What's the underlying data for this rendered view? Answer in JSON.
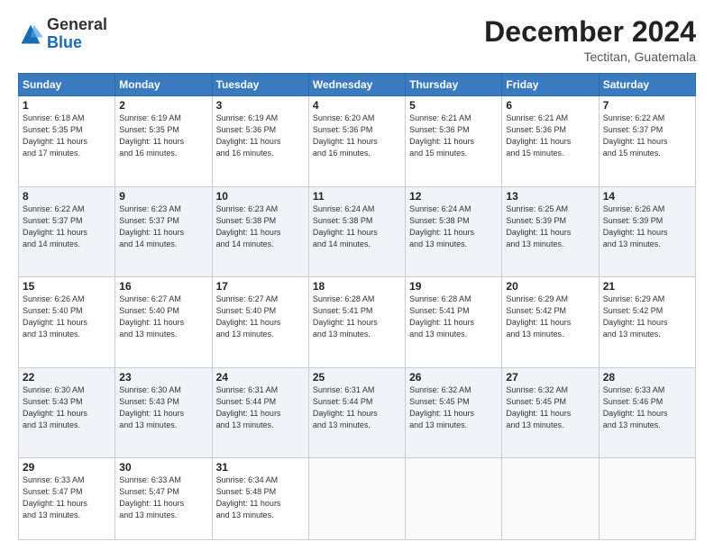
{
  "header": {
    "logo_general": "General",
    "logo_blue": "Blue",
    "month_title": "December 2024",
    "location": "Tectitan, Guatemala"
  },
  "days_of_week": [
    "Sunday",
    "Monday",
    "Tuesday",
    "Wednesday",
    "Thursday",
    "Friday",
    "Saturday"
  ],
  "weeks": [
    [
      {
        "day": "1",
        "info": "Sunrise: 6:18 AM\nSunset: 5:35 PM\nDaylight: 11 hours\nand 17 minutes."
      },
      {
        "day": "2",
        "info": "Sunrise: 6:19 AM\nSunset: 5:35 PM\nDaylight: 11 hours\nand 16 minutes."
      },
      {
        "day": "3",
        "info": "Sunrise: 6:19 AM\nSunset: 5:36 PM\nDaylight: 11 hours\nand 16 minutes."
      },
      {
        "day": "4",
        "info": "Sunrise: 6:20 AM\nSunset: 5:36 PM\nDaylight: 11 hours\nand 16 minutes."
      },
      {
        "day": "5",
        "info": "Sunrise: 6:21 AM\nSunset: 5:36 PM\nDaylight: 11 hours\nand 15 minutes."
      },
      {
        "day": "6",
        "info": "Sunrise: 6:21 AM\nSunset: 5:36 PM\nDaylight: 11 hours\nand 15 minutes."
      },
      {
        "day": "7",
        "info": "Sunrise: 6:22 AM\nSunset: 5:37 PM\nDaylight: 11 hours\nand 15 minutes."
      }
    ],
    [
      {
        "day": "8",
        "info": "Sunrise: 6:22 AM\nSunset: 5:37 PM\nDaylight: 11 hours\nand 14 minutes."
      },
      {
        "day": "9",
        "info": "Sunrise: 6:23 AM\nSunset: 5:37 PM\nDaylight: 11 hours\nand 14 minutes."
      },
      {
        "day": "10",
        "info": "Sunrise: 6:23 AM\nSunset: 5:38 PM\nDaylight: 11 hours\nand 14 minutes."
      },
      {
        "day": "11",
        "info": "Sunrise: 6:24 AM\nSunset: 5:38 PM\nDaylight: 11 hours\nand 14 minutes."
      },
      {
        "day": "12",
        "info": "Sunrise: 6:24 AM\nSunset: 5:38 PM\nDaylight: 11 hours\nand 13 minutes."
      },
      {
        "day": "13",
        "info": "Sunrise: 6:25 AM\nSunset: 5:39 PM\nDaylight: 11 hours\nand 13 minutes."
      },
      {
        "day": "14",
        "info": "Sunrise: 6:26 AM\nSunset: 5:39 PM\nDaylight: 11 hours\nand 13 minutes."
      }
    ],
    [
      {
        "day": "15",
        "info": "Sunrise: 6:26 AM\nSunset: 5:40 PM\nDaylight: 11 hours\nand 13 minutes."
      },
      {
        "day": "16",
        "info": "Sunrise: 6:27 AM\nSunset: 5:40 PM\nDaylight: 11 hours\nand 13 minutes."
      },
      {
        "day": "17",
        "info": "Sunrise: 6:27 AM\nSunset: 5:40 PM\nDaylight: 11 hours\nand 13 minutes."
      },
      {
        "day": "18",
        "info": "Sunrise: 6:28 AM\nSunset: 5:41 PM\nDaylight: 11 hours\nand 13 minutes."
      },
      {
        "day": "19",
        "info": "Sunrise: 6:28 AM\nSunset: 5:41 PM\nDaylight: 11 hours\nand 13 minutes."
      },
      {
        "day": "20",
        "info": "Sunrise: 6:29 AM\nSunset: 5:42 PM\nDaylight: 11 hours\nand 13 minutes."
      },
      {
        "day": "21",
        "info": "Sunrise: 6:29 AM\nSunset: 5:42 PM\nDaylight: 11 hours\nand 13 minutes."
      }
    ],
    [
      {
        "day": "22",
        "info": "Sunrise: 6:30 AM\nSunset: 5:43 PM\nDaylight: 11 hours\nand 13 minutes."
      },
      {
        "day": "23",
        "info": "Sunrise: 6:30 AM\nSunset: 5:43 PM\nDaylight: 11 hours\nand 13 minutes."
      },
      {
        "day": "24",
        "info": "Sunrise: 6:31 AM\nSunset: 5:44 PM\nDaylight: 11 hours\nand 13 minutes."
      },
      {
        "day": "25",
        "info": "Sunrise: 6:31 AM\nSunset: 5:44 PM\nDaylight: 11 hours\nand 13 minutes."
      },
      {
        "day": "26",
        "info": "Sunrise: 6:32 AM\nSunset: 5:45 PM\nDaylight: 11 hours\nand 13 minutes."
      },
      {
        "day": "27",
        "info": "Sunrise: 6:32 AM\nSunset: 5:45 PM\nDaylight: 11 hours\nand 13 minutes."
      },
      {
        "day": "28",
        "info": "Sunrise: 6:33 AM\nSunset: 5:46 PM\nDaylight: 11 hours\nand 13 minutes."
      }
    ],
    [
      {
        "day": "29",
        "info": "Sunrise: 6:33 AM\nSunset: 5:47 PM\nDaylight: 11 hours\nand 13 minutes."
      },
      {
        "day": "30",
        "info": "Sunrise: 6:33 AM\nSunset: 5:47 PM\nDaylight: 11 hours\nand 13 minutes."
      },
      {
        "day": "31",
        "info": "Sunrise: 6:34 AM\nSunset: 5:48 PM\nDaylight: 11 hours\nand 13 minutes."
      },
      {
        "day": "",
        "info": ""
      },
      {
        "day": "",
        "info": ""
      },
      {
        "day": "",
        "info": ""
      },
      {
        "day": "",
        "info": ""
      }
    ]
  ]
}
